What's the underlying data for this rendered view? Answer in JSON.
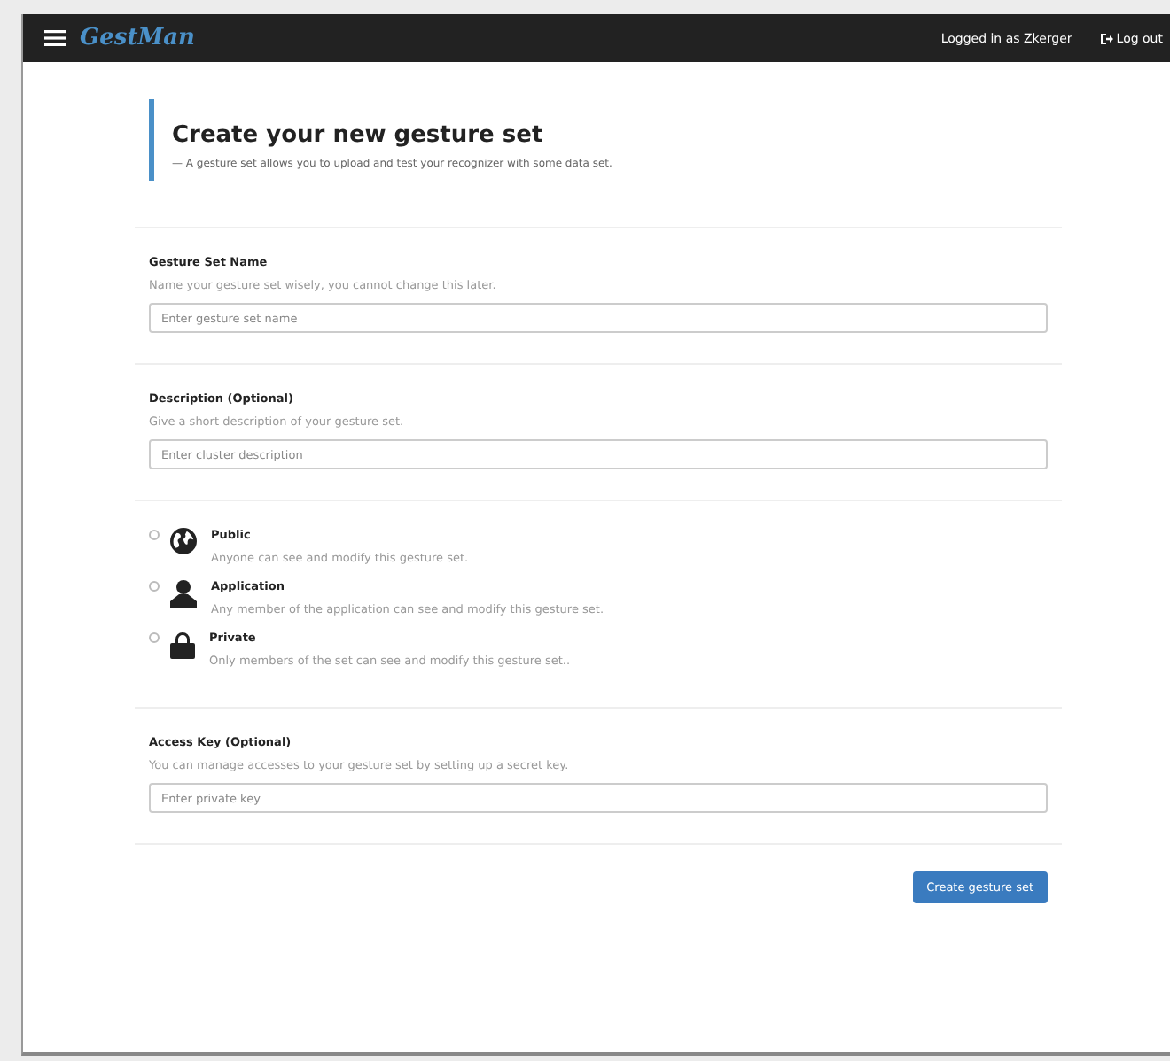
{
  "navbar": {
    "brand": "GestMan",
    "user": "Logged in as Zkerger",
    "logout": "Log out"
  },
  "header": {
    "title": "Create your new gesture set",
    "subtitle": "— A gesture set allows you to upload and test your recognizer with some data set."
  },
  "name_field": {
    "label": "Gesture Set Name",
    "hint": "Name your gesture set wisely, you cannot change this later.",
    "placeholder": "Enter gesture set name"
  },
  "description_field": {
    "label": "Description (Optional)",
    "hint": "Give a short description of your gesture set.",
    "placeholder": "Enter cluster description"
  },
  "visibility": [
    {
      "kind": "globe",
      "label": "Public",
      "description": "Anyone can see and modify this gesture set.",
      "selected": false
    },
    {
      "kind": "person",
      "label": "Application",
      "description": "Any member of the application can see and modify this gesture set.",
      "selected": false
    },
    {
      "kind": "lock",
      "label": "Private",
      "description": "Only members of the set can see and modify this gesture set..",
      "selected": false
    }
  ],
  "access_key_field": {
    "label": "Access Key (Optional)",
    "hint": "You can manage accesses to your gesture set by setting up a secret key.",
    "placeholder": "Enter private key"
  },
  "submit_button": "Create gesture set"
}
